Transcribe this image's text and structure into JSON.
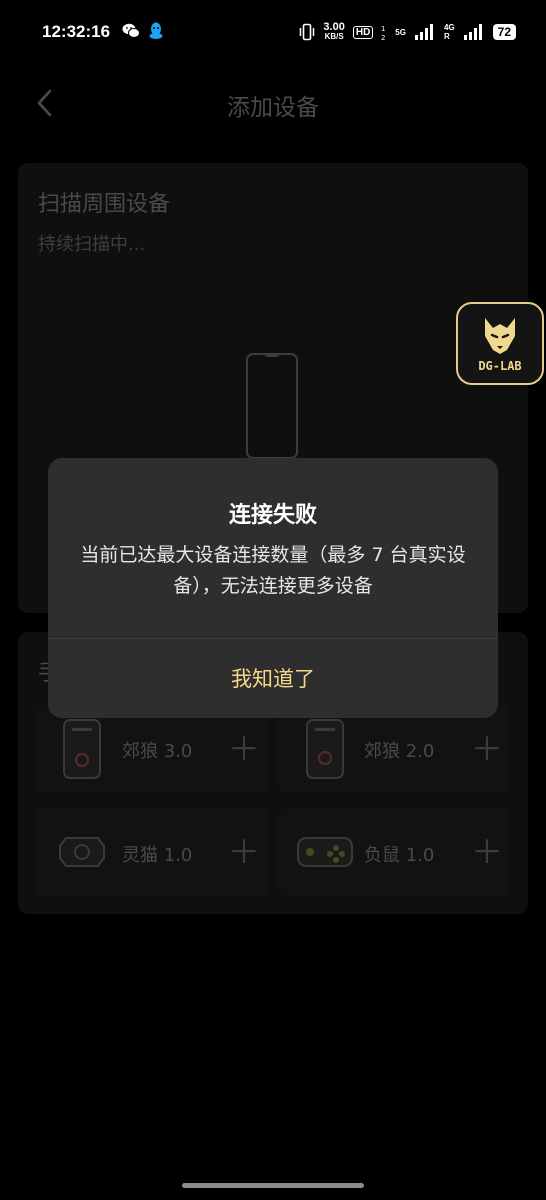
{
  "status_bar": {
    "time": "12:32:16",
    "net_speed_value": "3.00",
    "net_speed_unit": "KB/S",
    "hd_label": "HD",
    "sim1_label": "5G",
    "sim2_label": "4G",
    "sim2_sub": "R",
    "battery": "72"
  },
  "header": {
    "title": "添加设备"
  },
  "scan": {
    "title": "扫描周围设备",
    "status": "持续扫描中..."
  },
  "manual": {
    "title_fragment": "手",
    "devices": [
      {
        "label": "郊狼 3.0",
        "icon": "coyote-3-device-icon"
      },
      {
        "label": "郊狼 2.0",
        "icon": "coyote-2-device-icon"
      },
      {
        "label": "灵猫 1.0",
        "icon": "lingmao-device-icon"
      },
      {
        "label": "负鼠 1.0",
        "icon": "fushu-device-icon"
      }
    ]
  },
  "floating": {
    "logo_text": "DG-LAB"
  },
  "dialog": {
    "title": "连接失败",
    "message": "当前已达最大设备连接数量（最多 7 台真实设备），无法连接更多设备",
    "ok_label": "我知道了"
  },
  "colors": {
    "accent": "#f3d987",
    "dialog_bg": "#2e2e2e",
    "page_bg": "#000000"
  }
}
